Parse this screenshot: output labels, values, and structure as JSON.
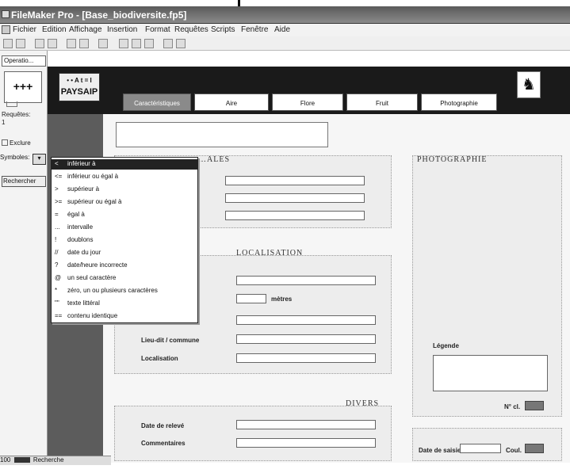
{
  "window": {
    "title": "FileMaker Pro - [Base_biodiversite.fp5]"
  },
  "menu": [
    "Fichier",
    "Edition",
    "Affichage",
    "Insertion",
    "Format",
    "Requêtes",
    "Scripts",
    "Fenêtre",
    "Aide"
  ],
  "left_panel": {
    "mode_select": "Operatio...",
    "requests_label": "Requêtes:",
    "requests_count": "1",
    "exclude_label": "Exclure",
    "symbols_label": "Symboles:",
    "search_button": "Rechercher"
  },
  "status_bar": {
    "zoom": "100",
    "mode": "Recherche"
  },
  "header": {
    "logo_top": "• • A t = I",
    "logo_bottom": "PAYSAIP",
    "crest": "♞"
  },
  "tabs": [
    "Caractéristiques",
    "Aire",
    "Flore",
    "Fruit",
    "Photographie"
  ],
  "sections": {
    "generales_title": "…ALES",
    "localisation_title": "LOCALISATION",
    "divers_title": "DIVERS",
    "photographie_title": "PHOTOGRAPHIE"
  },
  "fields": {
    "localisation_unit": "mètres",
    "label_commune": "Lieu-dit / commune",
    "label_localisation": "Localisation",
    "label_divers1": "Date de relevé",
    "label_divers2": "Commentaires",
    "label_legende": "Légende",
    "label_no": "N° cl.",
    "label_date_saisie": "Date de saisie",
    "label_color": "Coul."
  },
  "symbols_menu": [
    {
      "sym": "<",
      "label": "inférieur à"
    },
    {
      "sym": "<=",
      "label": "inférieur ou égal à"
    },
    {
      "sym": ">",
      "label": "supérieur à"
    },
    {
      "sym": ">=",
      "label": "supérieur ou égal à"
    },
    {
      "sym": "=",
      "label": "égal à"
    },
    {
      "sym": "...",
      "label": "intervalle"
    },
    {
      "sym": "!",
      "label": "doublons"
    },
    {
      "sym": "//",
      "label": "date du jour"
    },
    {
      "sym": "?",
      "label": "date/heure incorrecte"
    },
    {
      "sym": "@",
      "label": "un seul caractère"
    },
    {
      "sym": "*",
      "label": "zéro, un ou plusieurs caractères"
    },
    {
      "sym": "\"\"",
      "label": "texte littéral"
    },
    {
      "sym": "==",
      "label": "contenu identique"
    }
  ]
}
